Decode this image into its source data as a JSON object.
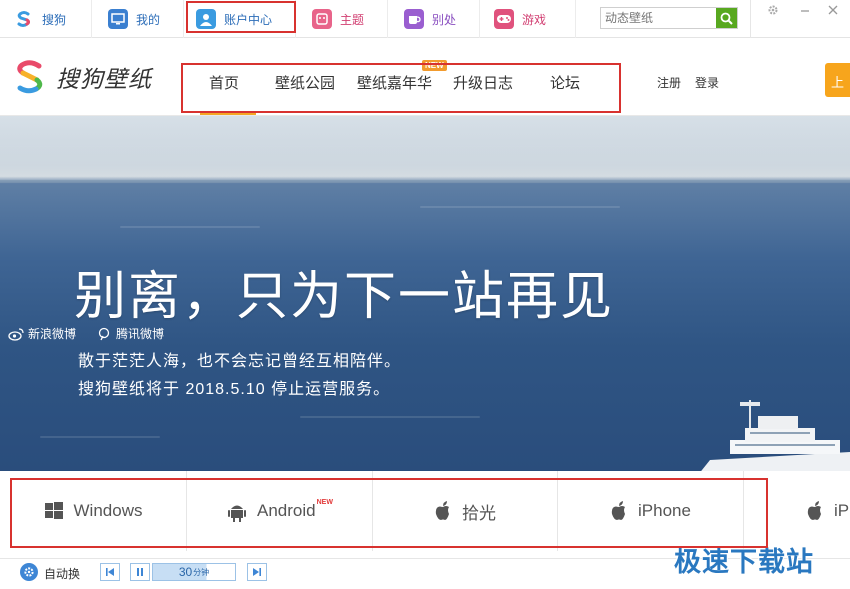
{
  "topbar": {
    "tabs": [
      {
        "id": "sogou",
        "label": "搜狗",
        "icon": "sogou-logo-icon"
      },
      {
        "id": "mine",
        "label": "我的",
        "icon": "monitor-icon"
      },
      {
        "id": "account",
        "label": "账户中心",
        "icon": "user-icon"
      },
      {
        "id": "theme",
        "label": "主题",
        "icon": "theme-icon"
      },
      {
        "id": "other",
        "label": "别处",
        "icon": "cup-icon"
      },
      {
        "id": "game",
        "label": "游戏",
        "icon": "gamepad-icon"
      }
    ],
    "search_placeholder": "动态壁纸",
    "colors": {
      "accent_blue": "#2c6db8",
      "search_green": "#58a820",
      "highlight_red": "#d8322f"
    }
  },
  "header": {
    "logo_text": "搜狗壁纸",
    "nav": [
      {
        "label": "首页"
      },
      {
        "label": "壁纸公园"
      },
      {
        "label": "壁纸嘉年华",
        "badge": "NEW"
      },
      {
        "label": "升级日志"
      },
      {
        "label": "论坛"
      }
    ],
    "register": "注册",
    "login": "登录",
    "orange_button": "上"
  },
  "banner": {
    "headline": "别离，只为下一站再见",
    "weibo_sina": "新浪微博",
    "weibo_tencent": "腾讯微博",
    "line1": "散于茫茫人海，也不会忘记曾经互相陪伴。",
    "line2": "搜狗壁纸将于 2018.5.10 停止运营服务。"
  },
  "platforms": [
    {
      "label": "Windows",
      "icon": "windows-icon"
    },
    {
      "label": "Android",
      "icon": "android-icon",
      "badge": "NEW"
    },
    {
      "label": "拾光",
      "icon": "apple-icon"
    },
    {
      "label": "iPhone",
      "icon": "apple-icon"
    },
    {
      "label": "iP",
      "icon": "apple-icon"
    }
  ],
  "bottombar": {
    "auto_label": "自动换",
    "interval_value": "30",
    "interval_unit": "分钟"
  },
  "watermark": "极速下载站"
}
